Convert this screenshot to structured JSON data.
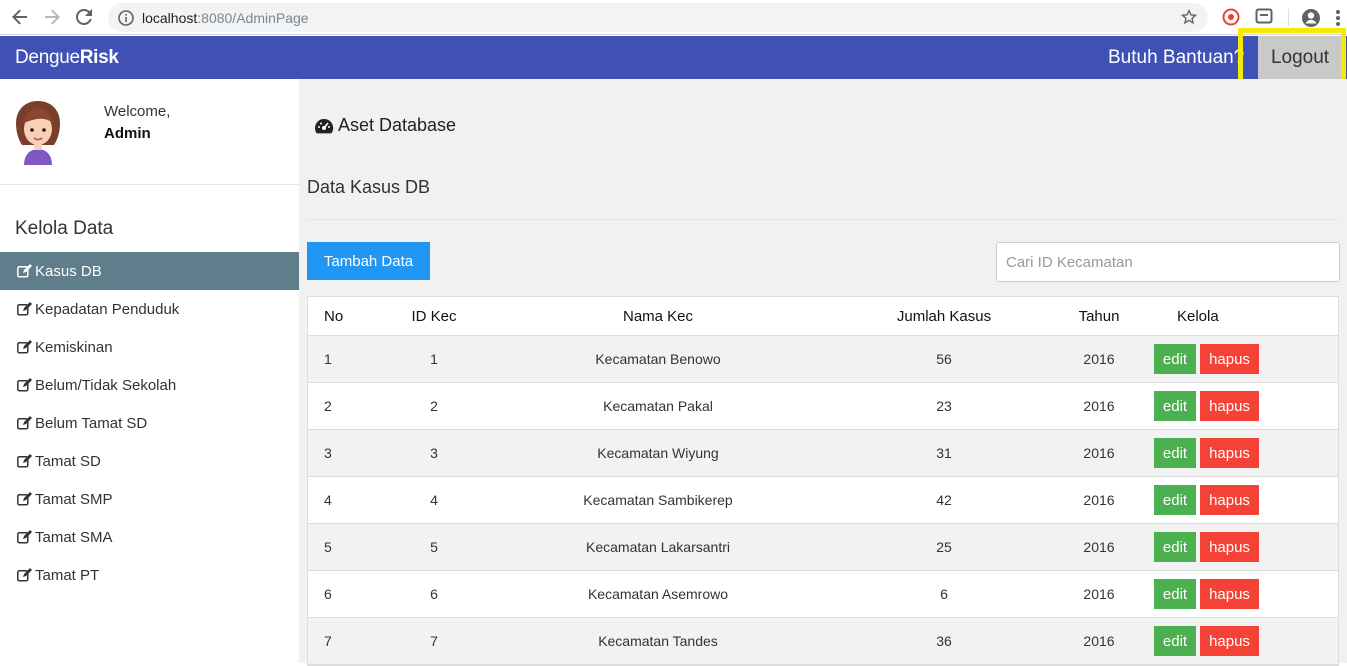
{
  "browser": {
    "url_host": "localhost",
    "url_rest": ":8080/AdminPage"
  },
  "navbar": {
    "brand_light": "Dengue",
    "brand_bold": "Risk",
    "help": "Butuh Bantuan?",
    "logout": "Logout",
    "highlight_color": "#f5ea06",
    "bar_color": "#3f51b5"
  },
  "sidebar": {
    "welcome": "Welcome,",
    "user": "Admin",
    "section_title": "Kelola Data",
    "items": [
      {
        "label": "Kasus DB",
        "active": true
      },
      {
        "label": "Kepadatan Penduduk"
      },
      {
        "label": "Kemiskinan"
      },
      {
        "label": "Belum/Tidak Sekolah"
      },
      {
        "label": "Belum Tamat SD"
      },
      {
        "label": "Tamat SD"
      },
      {
        "label": "Tamat SMP"
      },
      {
        "label": "Tamat SMA"
      },
      {
        "label": "Tamat PT"
      }
    ]
  },
  "main": {
    "page_title": "Aset Database",
    "section_title": "Data Kasus DB",
    "add_button": "Tambah Data",
    "search_placeholder": "Cari ID Kecamatan",
    "columns": [
      "No",
      "ID Kec",
      "Nama Kec",
      "Jumlah Kasus",
      "Tahun",
      "Kelola"
    ],
    "edit_label": "edit",
    "delete_label": "hapus",
    "rows": [
      {
        "no": "1",
        "id": "1",
        "nama": "Kecamatan Benowo",
        "jumlah": "56",
        "tahun": "2016"
      },
      {
        "no": "2",
        "id": "2",
        "nama": "Kecamatan Pakal",
        "jumlah": "23",
        "tahun": "2016"
      },
      {
        "no": "3",
        "id": "3",
        "nama": "Kecamatan Wiyung",
        "jumlah": "31",
        "tahun": "2016"
      },
      {
        "no": "4",
        "id": "4",
        "nama": "Kecamatan Sambikerep",
        "jumlah": "42",
        "tahun": "2016"
      },
      {
        "no": "5",
        "id": "5",
        "nama": "Kecamatan Lakarsantri",
        "jumlah": "25",
        "tahun": "2016"
      },
      {
        "no": "6",
        "id": "6",
        "nama": "Kecamatan Asemrowo",
        "jumlah": "6",
        "tahun": "2016"
      },
      {
        "no": "7",
        "id": "7",
        "nama": "Kecamatan Tandes",
        "jumlah": "36",
        "tahun": "2016"
      }
    ]
  }
}
